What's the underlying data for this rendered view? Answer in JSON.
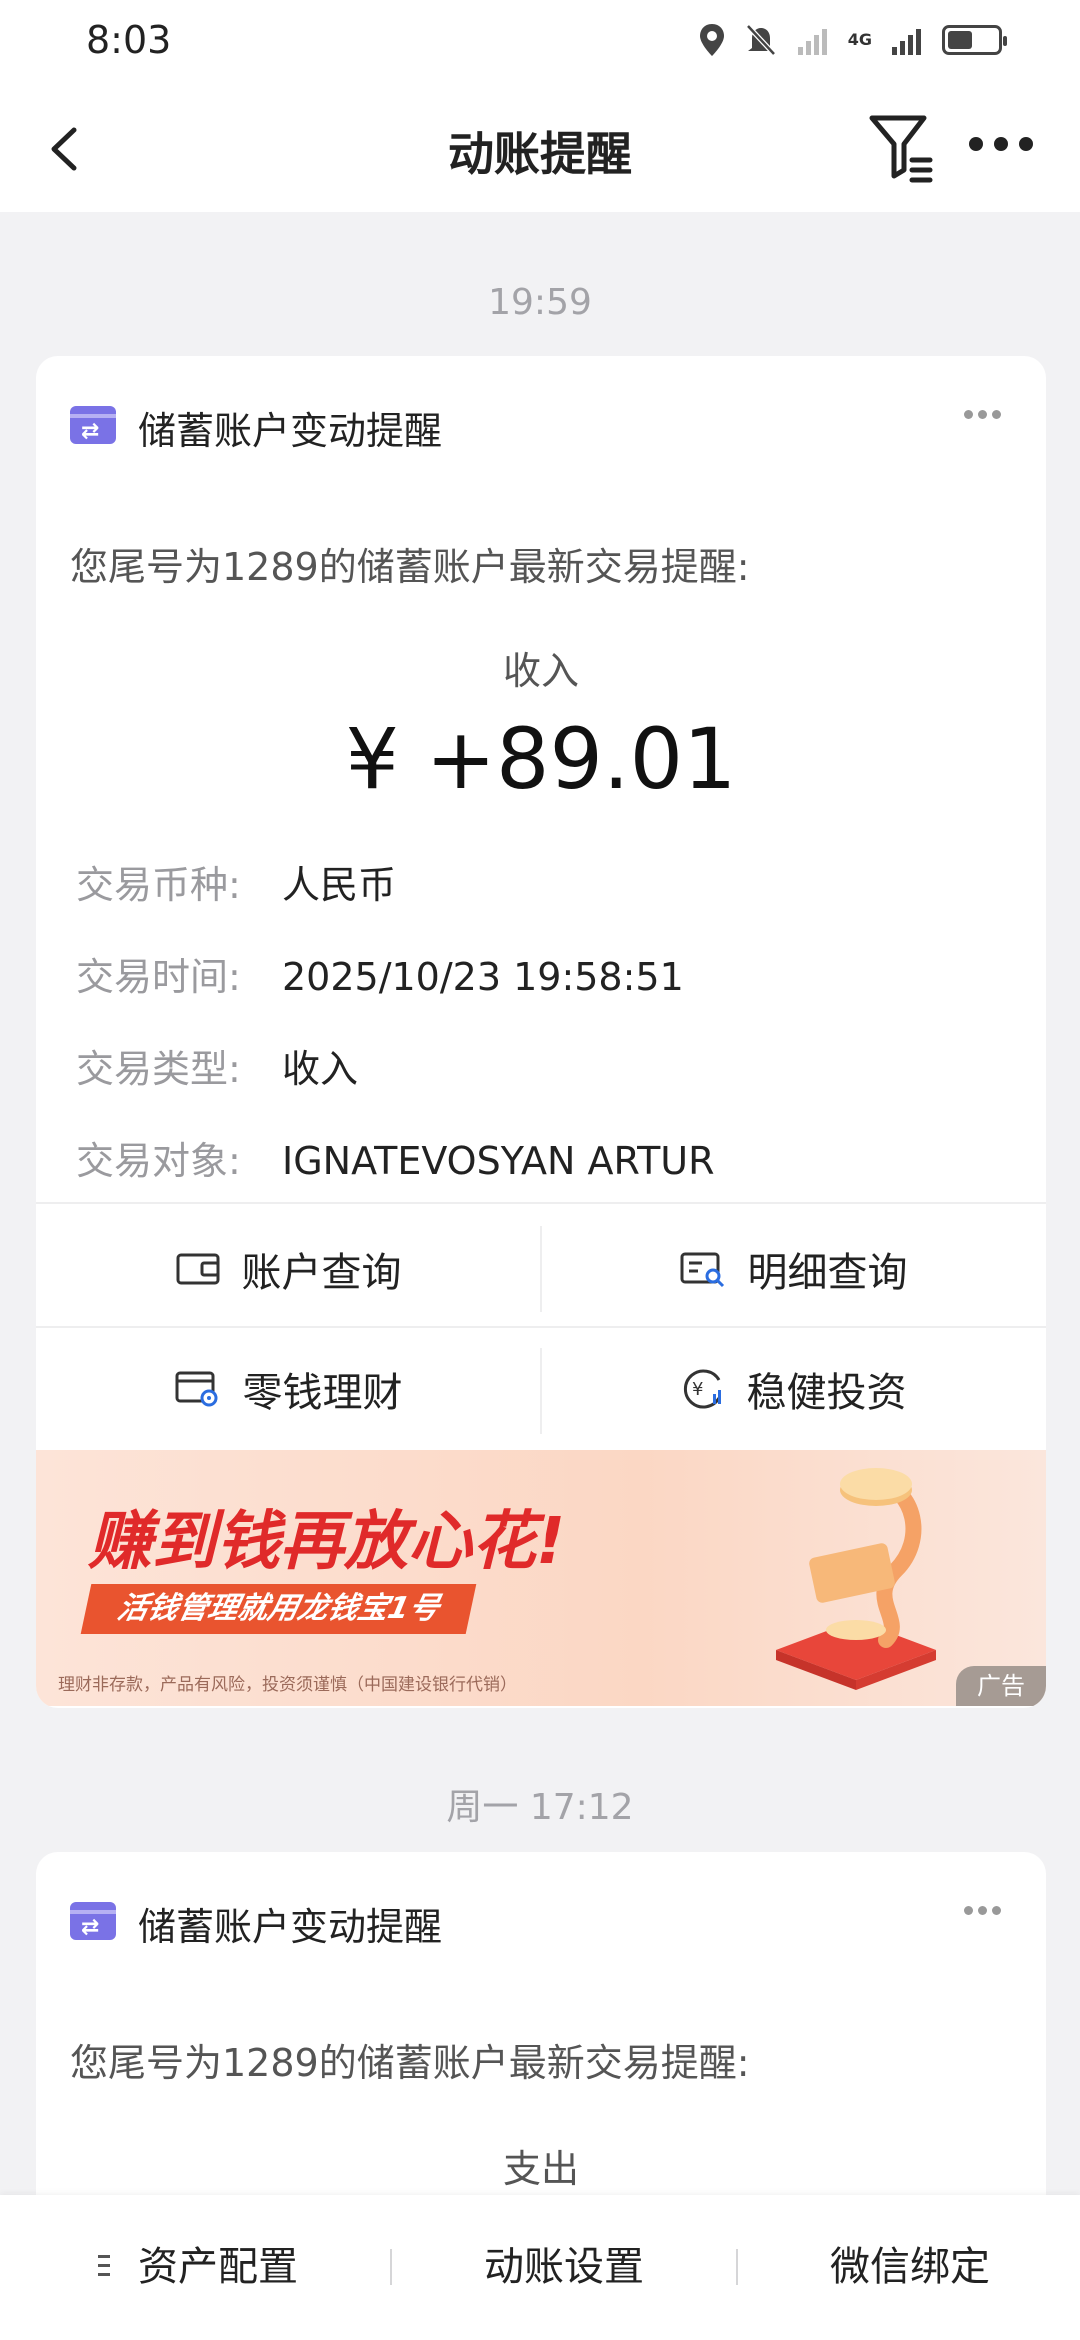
{
  "status_bar": {
    "time": "8:03",
    "network": "4G",
    "battery_level": 0.5
  },
  "header": {
    "title": "动账提醒"
  },
  "messages": [
    {
      "time": "19:59",
      "title": "储蓄账户变动提醒",
      "intro": "您尾号为1289的储蓄账户最新交易提醒:",
      "type_label": "收入",
      "amount": "¥ +89.01",
      "details": [
        {
          "label": "交易币种:",
          "value": "人民币"
        },
        {
          "label": "交易时间:",
          "value": "2025/10/23 19:58:51"
        },
        {
          "label": "交易类型:",
          "value": "收入"
        },
        {
          "label": "交易对象:",
          "value": "IGNATEVOSYAN ARTUR"
        }
      ],
      "actions": [
        {
          "label": "账户查询",
          "icon": "wallet-icon"
        },
        {
          "label": "明细查询",
          "icon": "statement-search-icon"
        },
        {
          "label": "零钱理财",
          "icon": "card-finance-icon"
        },
        {
          "label": "稳健投资",
          "icon": "yuan-investment-icon"
        }
      ],
      "ad": {
        "headline": "赚到钱再放心花!",
        "subline": "活钱管理就用龙钱宝1号",
        "disclaimer": "理财非存款，产品有风险，投资须谨慎（中国建设银行代销）",
        "badge": "广告"
      }
    },
    {
      "time": "周一 17:12",
      "title": "储蓄账户变动提醒",
      "intro": "您尾号为1289的储蓄账户最新交易提醒:",
      "type_label": "支出"
    }
  ],
  "bottom_bar": {
    "items": [
      "资产配置",
      "动账设置",
      "微信绑定"
    ]
  },
  "colors": {
    "accent_purple": "#7a72e6",
    "ad_red": "#e02a2a",
    "ad_orange": "#e9542f"
  }
}
